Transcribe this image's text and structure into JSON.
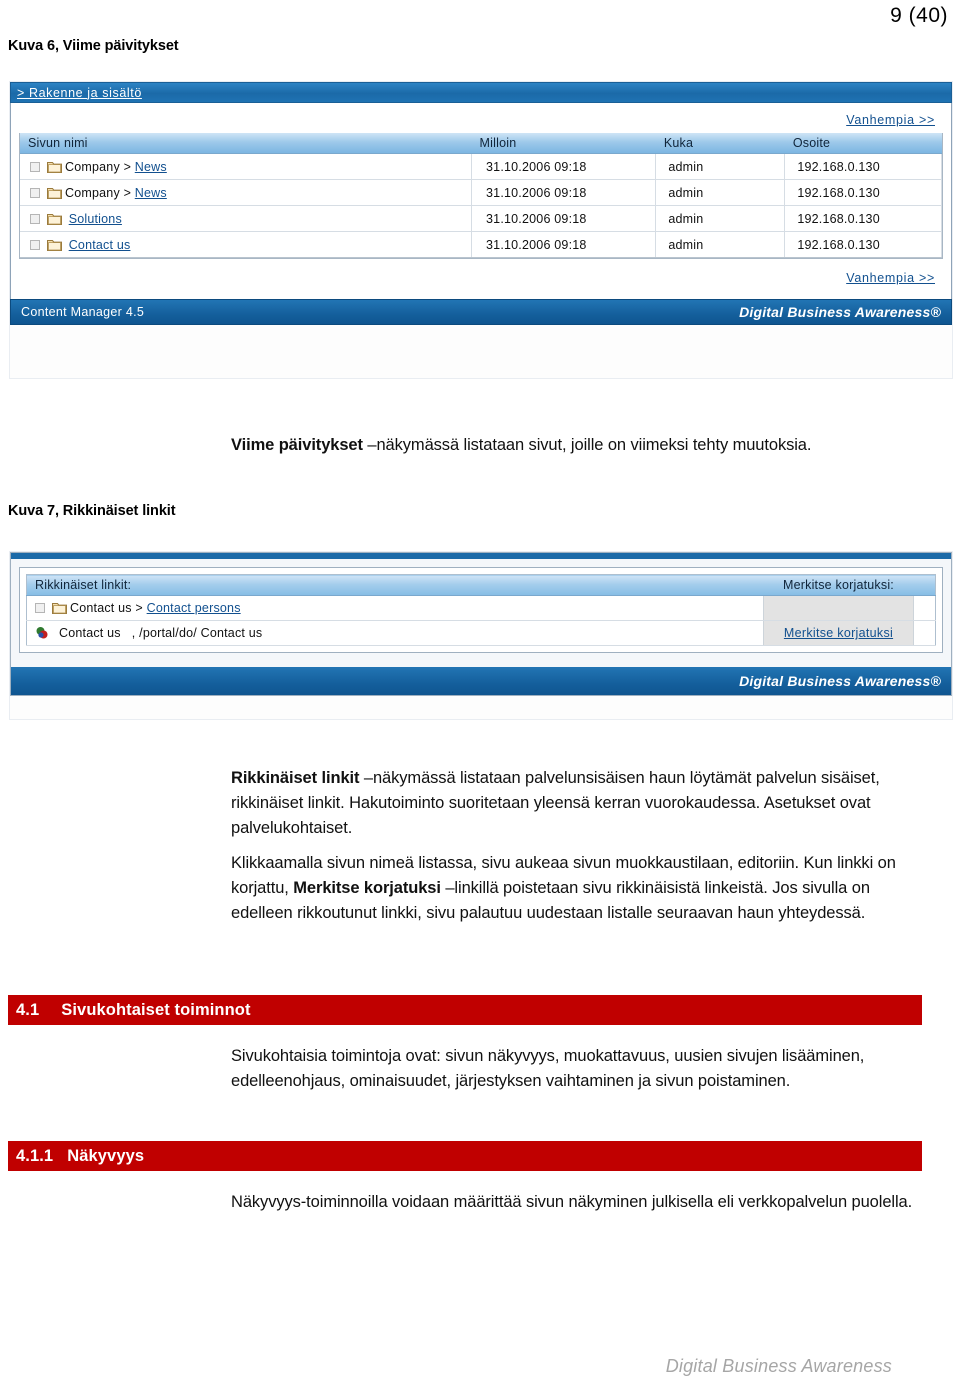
{
  "page": {
    "number": "9 (40)",
    "footer_watermark": "Digital Business Awareness"
  },
  "captions": {
    "figure6": "Kuva 6, Viime päivitykset",
    "figure7": "Kuva 7, Rikkinäiset linkit"
  },
  "screenshot_last_updates": {
    "breadcrumb": "> Rakenne ja sisältö",
    "older_link_top": "Vanhempia >>",
    "older_link_bottom": "Vanhempia >>",
    "columns": [
      "Sivun nimi",
      "Milloin",
      "Kuka",
      "Osoite"
    ],
    "rows": [
      {
        "parent": "Company >",
        "link": "News",
        "when": "31.10.2006 09:18",
        "who": "admin",
        "ip": "192.168.0.130"
      },
      {
        "parent": "Company >",
        "link": "News",
        "when": "31.10.2006 09:18",
        "who": "admin",
        "ip": "192.168.0.130"
      },
      {
        "parent": "",
        "link": "Solutions",
        "when": "31.10.2006 09:18",
        "who": "admin",
        "ip": "192.168.0.130"
      },
      {
        "parent": "",
        "link": "Contact us",
        "when": "31.10.2006 09:18",
        "who": "admin",
        "ip": "192.168.0.130"
      }
    ],
    "footer_left": "Content Manager 4.5",
    "footer_right": "Digital Business Awareness®"
  },
  "screenshot_broken_links": {
    "columns": [
      "Rikkinäiset linkit:",
      "Merkitse korjatuksi:"
    ],
    "page_row": {
      "parent": "Contact us >",
      "link": "Contact persons"
    },
    "link_row": {
      "label": "Contact us",
      "url": ", /portal/do/ Contact us",
      "action": "Merkitse korjatuksi"
    },
    "footer_right": "Digital Business Awareness®"
  },
  "body": {
    "viime_paivitykset": {
      "bold": "Viime päivitykset",
      "rest": " –näkymässä listataan sivut, joille on viimeksi tehty muutoksia."
    },
    "rikkinaiset_p1": {
      "bold": "Rikkinäiset linkit",
      "rest": " –näkymässä listataan palvelunsisäisen haun löytämät palvelun sisäiset, rikkinäiset linkit. Hakutoiminto suoritetaan yleensä kerran vuorokaudessa. Asetukset ovat palvelukohtaiset."
    },
    "rikkinaiset_p2": {
      "before": "Klikkaamalla sivun nimeä listassa, sivu aukeaa sivun muokkaustilaan, editoriin. Kun linkki on korjattu, ",
      "bold": "Merkitse korjatuksi",
      "after": " –linkillä poistetaan sivu rikkinäisistä linkeistä. Jos sivulla on edelleen rikkoutunut linkki, sivu palautuu uudestaan listalle seuraavan haun yhteydessä."
    },
    "sivukohtaiset_text": "Sivukohtaisia toimintoja ovat: sivun näkyvyys, muokattavuus, uusien sivujen lisääminen, edelleenohjaus, ominaisuudet, järjestyksen vaihtaminen ja sivun poistaminen.",
    "nakyvyys_text": "Näkyvyys-toiminnoilla voidaan määrittää sivun näkyminen julkisella eli verkkopalvelun puolella."
  },
  "headings": {
    "h41": {
      "number": "4.1",
      "title": "Sivukohtaiset toiminnot"
    },
    "h411": {
      "number": "4.1.1",
      "title": "Näkyvyys"
    }
  },
  "colors": {
    "heading_red": "#c00000",
    "cm_blue": "#1b6aa8",
    "link_blue": "#12508f",
    "watermark_grey": "#a6a6a6"
  }
}
